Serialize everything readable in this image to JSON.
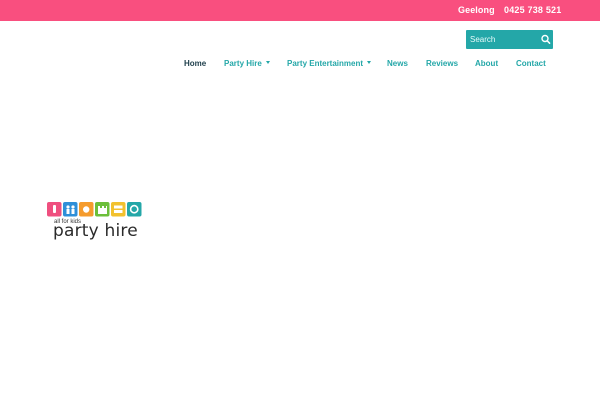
{
  "topbar": {
    "location": "Geelong",
    "phone": "0425 738 521",
    "background": "#f94f7f"
  },
  "search": {
    "placeholder": "Search",
    "icon": "search-icon",
    "background": "#24a7a8"
  },
  "nav": {
    "items": [
      {
        "label": "Home",
        "active": true
      },
      {
        "label": "Party Hire",
        "dropdown": true
      },
      {
        "label": "Party Entertainment",
        "dropdown": true
      },
      {
        "label": "News"
      },
      {
        "label": "Reviews"
      },
      {
        "label": "About"
      },
      {
        "label": "Contact"
      }
    ],
    "active_color": "#1d3d4a",
    "link_color": "#24a7a8"
  },
  "logo": {
    "tagline": "all for kids",
    "brand": "party hire",
    "tile_colors": [
      "#ef4f7f",
      "#2f8fd8",
      "#f59b2c",
      "#6cbf3a",
      "#f2c12e",
      "#24a7a8"
    ]
  }
}
